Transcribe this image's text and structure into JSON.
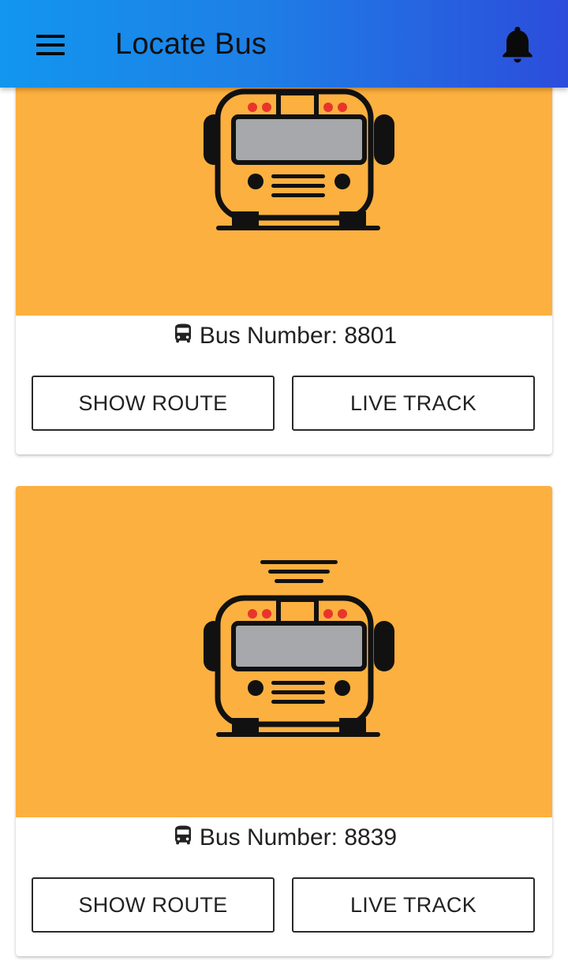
{
  "app": {
    "title": "Locate Bus",
    "gradient_start": "#1296ee",
    "gradient_end": "#2c4ddb",
    "menu_icon": "hamburger-menu-icon",
    "notification_icon": "bell-icon"
  },
  "theme": {
    "card_media_bg": "#fcb03f",
    "bus_body": "#fcb03f",
    "bus_window": "#a6a8ab",
    "bus_lights": "#e8352c"
  },
  "buses": [
    {
      "label": "Bus Number: 8801",
      "image_icon": "school-bus-icon",
      "show_route_label": "SHOW ROUTE",
      "live_track_label": "LIVE TRACK"
    },
    {
      "label": "Bus Number: 8839",
      "image_icon": "school-bus-live-signal-icon",
      "show_route_label": "SHOW ROUTE",
      "live_track_label": "LIVE TRACK"
    }
  ]
}
